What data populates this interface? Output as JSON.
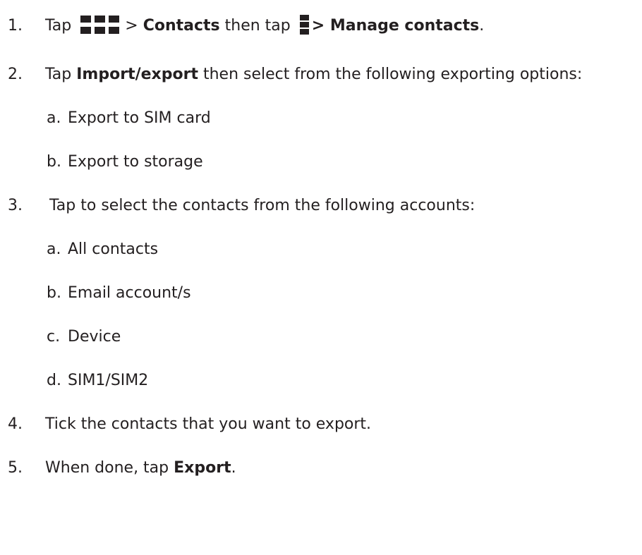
{
  "steps": [
    {
      "number": "1.",
      "parts": {
        "tap": "Tap",
        "sep": ">",
        "contacts": "Contacts",
        "then_tap": "then tap",
        "manage": "> Manage contacts",
        "period": "."
      },
      "icons": [
        "apps-grid-icon",
        "overflow-menu-icon"
      ]
    },
    {
      "number": "2.",
      "parts": {
        "tap": "Tap",
        "import_export": "Import/export",
        "rest": "then select from the following exporting options:"
      }
    },
    {
      "number": "3.",
      "text": "Tap to select the contacts from the following accounts:"
    },
    {
      "number": "4.",
      "text": "Tick the contacts that you want to export."
    },
    {
      "number": "5.",
      "parts": {
        "when_done": "When done, tap",
        "export": "Export",
        "period": "."
      }
    }
  ],
  "export_options": [
    {
      "letter": "a.",
      "text": "Export to SIM card"
    },
    {
      "letter": "b.",
      "text": "Export to storage"
    }
  ],
  "account_options": [
    {
      "letter": "a.",
      "text": "All contacts"
    },
    {
      "letter": "b.",
      "text": "Email account/s"
    },
    {
      "letter": "c.",
      "text": "Device"
    },
    {
      "letter": "d.",
      "text": "SIM1/SIM2"
    }
  ],
  "colors": {
    "text": "#231f20",
    "icon": "#231f20",
    "background": "#ffffff"
  }
}
